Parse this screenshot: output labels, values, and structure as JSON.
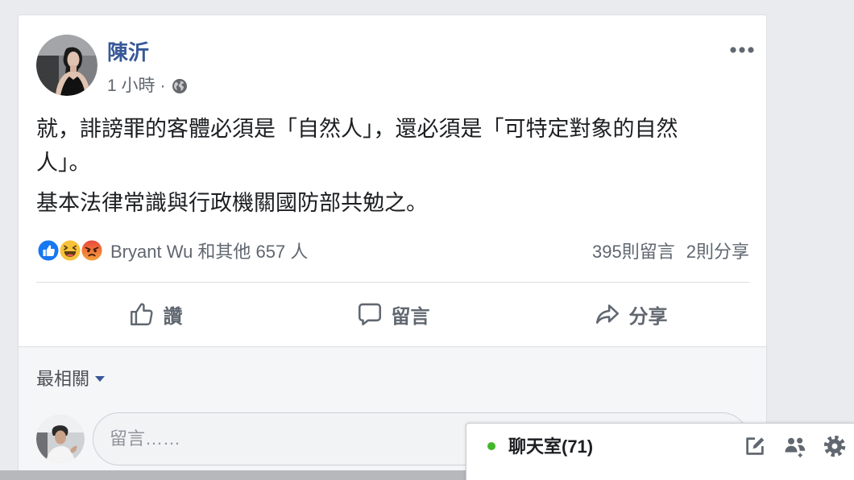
{
  "page": {
    "background": "#e9ebee"
  },
  "colors": {
    "accent": "#385898",
    "secondary_text": "#606770",
    "primary_text": "#1c1e21",
    "like_blue": "#1877f2",
    "haha_yellow": "#f7c23b",
    "angry_red": "#e9463b",
    "angry_orange": "#f6a53a",
    "online_green": "#42b72a",
    "divider": "#dadde1"
  },
  "post": {
    "author": "陳沂",
    "avatar_icon": "author-avatar",
    "time": "1 小時",
    "separator": "·",
    "privacy_icon": "globe-icon",
    "more_icon": "more-options-icon",
    "paragraphs": [
      "就，誹謗罪的客體必須是「自然人」，還必須是「可特定對象的自然人」。",
      "基本法律常識與行政機關國防部共勉之。"
    ]
  },
  "reactions": {
    "icons": [
      "like-reaction-icon",
      "haha-reaction-icon",
      "angry-reaction-icon"
    ],
    "summary": "Bryant Wu 和其他 657 人",
    "comments_count": "395則留言",
    "shares_count": "2則分享"
  },
  "actions": [
    {
      "label": "讚",
      "icon": "thumbs-up-icon"
    },
    {
      "label": "留言",
      "icon": "comment-icon"
    },
    {
      "label": "分享",
      "icon": "share-icon"
    }
  ],
  "comments": {
    "sort_label": "最相關",
    "sort_icon": "caret-down-icon",
    "input_placeholder": "留言……"
  },
  "chat": {
    "label": "聊天室(71)",
    "icons": [
      "compose-icon",
      "friends-icon",
      "gear-icon"
    ]
  }
}
